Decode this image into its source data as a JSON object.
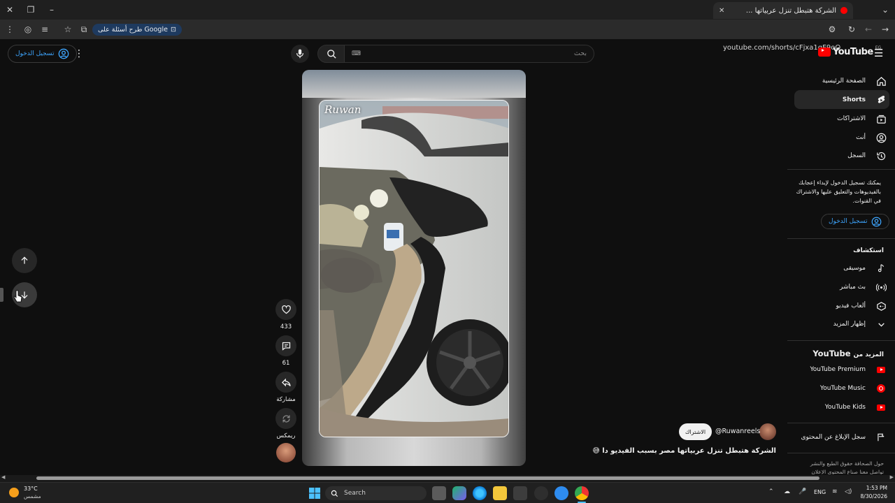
{
  "browser": {
    "tab_title": "الشركة هتبطل تنزل عربياتها ...",
    "google_chip": "طرح أسئلة على Google",
    "url": "youtube.com/shorts/cFjxa1qF9oQ"
  },
  "header": {
    "sign_in": "تسجيل الدخول",
    "search_placeholder": "بحث",
    "logo_text": "YouTube",
    "logo_region": "EG"
  },
  "sidebar": {
    "items": [
      {
        "label": "الصفحة الرئيسية",
        "icon": "home-icon"
      },
      {
        "label": "Shorts",
        "icon": "shorts-icon",
        "active": true
      },
      {
        "label": "الاشتراكات",
        "icon": "subscriptions-icon"
      },
      {
        "label": "أنت",
        "icon": "account-icon"
      },
      {
        "label": "السجل",
        "icon": "history-icon"
      }
    ],
    "signin_prompt": "يمكنك تسجيل الدخول لإبداء إعجابك بالفيديوهات والتعليق عليها والاشتراك في القنوات.",
    "signin_button": "تسجيل الدخول",
    "explore_title": "استكشاف",
    "explore": [
      {
        "label": "موسيقى",
        "icon": "music-icon"
      },
      {
        "label": "بث مباشر",
        "icon": "live-icon"
      },
      {
        "label": "ألعاب فيديو",
        "icon": "gaming-icon"
      },
      {
        "label": "إظهار المزيد",
        "icon": "chevron-down-icon"
      }
    ],
    "more_title_prefix": "المزيد من",
    "more_title_brand": "YouTube",
    "more": [
      {
        "label": "YouTube Premium"
      },
      {
        "label": "YouTube Music"
      },
      {
        "label": "YouTube Kids"
      }
    ],
    "report": "سجل الإبلاغ عن المحتوى",
    "footer_1": "حول  الصحافة  حقوق الطبع والنشر",
    "footer_2": "تواصل معنا  صناع المحتوى  الإعلان"
  },
  "short": {
    "watermark": "Ruwan",
    "likes": "433",
    "comments": "61",
    "share": "مشاركة",
    "remix": "ريمكس",
    "channel": "@Ruwanreels",
    "subscribe": "الاشتراك",
    "title": "الشركة هتبطل تنزل عربياتها مصر بسبب الفيديو دا 😅"
  },
  "taskbar": {
    "temp": "33°C",
    "weather": "مشمس",
    "search": "Search",
    "lang": "ENG",
    "time": "1:53 PM",
    "date": "8/30/2026"
  }
}
